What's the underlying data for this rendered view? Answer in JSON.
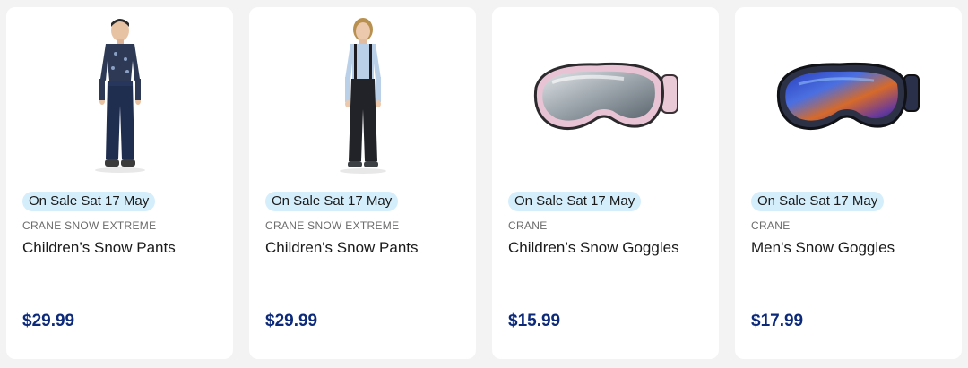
{
  "products": [
    {
      "badge": "On Sale Sat 17 May",
      "brand": "CRANE SNOW EXTREME",
      "title": "Children’s Snow Pants",
      "price": "$29.99",
      "image": "boy-snow-pants-photo"
    },
    {
      "badge": "On Sale Sat 17 May",
      "brand": "CRANE SNOW EXTREME",
      "title": "Children's Snow Pants",
      "price": "$29.99",
      "image": "girl-snow-pants-photo"
    },
    {
      "badge": "On Sale Sat 17 May",
      "brand": "CRANE",
      "title": "Children’s Snow Goggles",
      "price": "$15.99",
      "image": "pink-snow-goggles-photo"
    },
    {
      "badge": "On Sale Sat 17 May",
      "brand": "CRANE",
      "title": "Men's Snow Goggles",
      "price": "$17.99",
      "image": "blue-mirror-snow-goggles-photo"
    }
  ],
  "colors": {
    "page_background": "#f3f3f3",
    "badge_background": "#d5eefb",
    "price": "#0d2a7a"
  }
}
